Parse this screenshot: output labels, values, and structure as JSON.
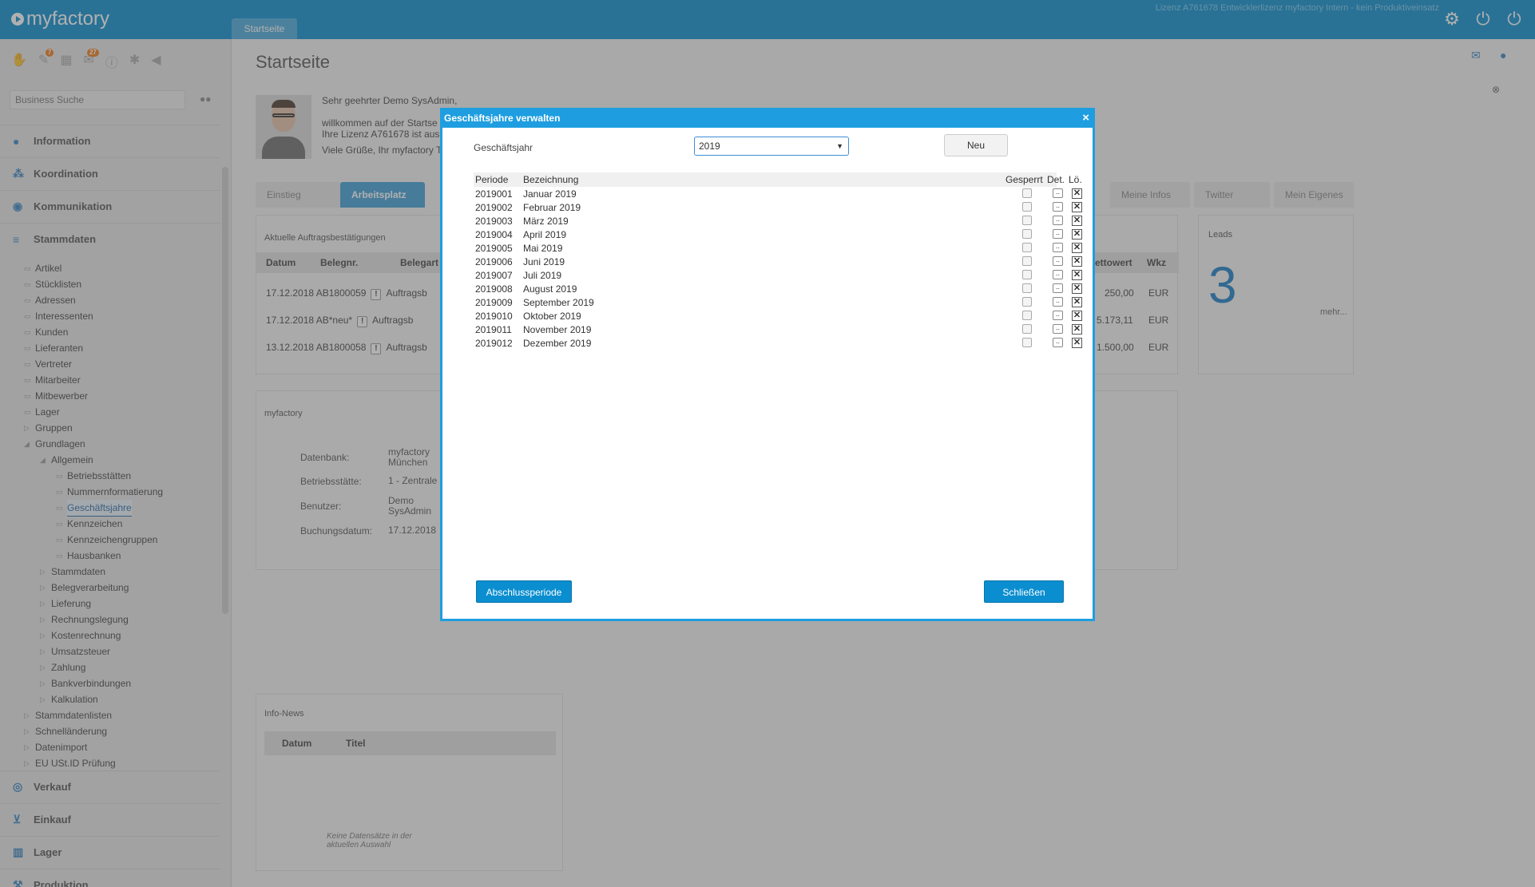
{
  "topbar": {
    "logo": "myfactory",
    "tab": "Startseite",
    "license": "Lizenz A761678 Entwicklerlizenz myfactory Intern - kein Produktiveinsatz",
    "icons": [
      "gear-icon",
      "power-icon",
      "power-plus-icon"
    ]
  },
  "sidebar": {
    "badges": {
      "b1": "7",
      "b2": "27"
    },
    "search_placeholder": "Business Suche",
    "sections_top": [
      "Information",
      "Koordination",
      "Kommunikation",
      "Stammdaten"
    ],
    "tree": [
      "Artikel",
      "Stücklisten",
      "Adressen",
      "Interessenten",
      "Kunden",
      "Lieferanten",
      "Vertreter",
      "Mitarbeiter",
      "Mitbewerber",
      "Lager",
      "Gruppen",
      "Grundlagen",
      "Allgemein",
      "Betriebsstätten",
      "Nummernformatierung",
      "Geschäftsjahre",
      "Kennzeichen",
      "Kennzeichengruppen",
      "Hausbanken",
      "Stammdaten",
      "Belegverarbeitung",
      "Lieferung",
      "Rechnungslegung",
      "Kostenrechnung",
      "Umsatzsteuer",
      "Zahlung",
      "Bankverbindungen",
      "Kalkulation",
      "Stammdatenlisten",
      "Schnelländerung",
      "Datenimport",
      "EU USt.ID Prüfung"
    ],
    "sections_bottom": [
      "Verkauf",
      "Einkauf",
      "Lager",
      "Produktion"
    ]
  },
  "main": {
    "title": "Startseite",
    "welcome": {
      "line1": "Sehr geehrter Demo SysAdmin,",
      "line2": "willkommen auf der Startse",
      "line3": "Ihre Lizenz A761678 ist aus",
      "line4": "Viele Grüße, Ihr myfactory T"
    },
    "tabs": [
      "Einstieg",
      "Arbeitsplatz",
      "Meine Infos",
      "Twitter",
      "Mein Eigenes"
    ],
    "orders": {
      "title": "Aktuelle Auftragsbestätigungen",
      "cols": [
        "Datum",
        "Belegnr.",
        "Belegart",
        "ettowert",
        "Wkz"
      ],
      "rows": [
        {
          "date": "17.12.2018",
          "nr": "AB1800059",
          "art": "Auftragsb",
          "value": "250,00",
          "cur": "EUR"
        },
        {
          "date": "17.12.2018",
          "nr": "AB*neu*",
          "art": "Auftragsb",
          "value": "5.173,11",
          "cur": "EUR"
        },
        {
          "date": "13.12.2018",
          "nr": "AB1800058",
          "art": "Auftragsb",
          "value": "1.500,00",
          "cur": "EUR"
        }
      ]
    },
    "leads": {
      "title": "Leads",
      "value": "3",
      "more": "mehr..."
    },
    "myfactory": {
      "title": "myfactory",
      "labels": [
        "Datenbank:",
        "Betriebsstätte:",
        "Benutzer:",
        "Buchungsdatum:"
      ],
      "values": [
        "myfactory München",
        "1 - Zentrale",
        "Demo SysAdmin",
        "17.12.2018"
      ]
    },
    "news": {
      "title": "Info-News",
      "cols": [
        "Datum",
        "Titel"
      ],
      "empty": "Keine Datensätze in der aktuellen Auswahl"
    }
  },
  "dialog": {
    "title": "Geschäftsjahre verwalten",
    "label_year": "Geschäftsjahr",
    "selected_year": "2019",
    "new_button": "Neu",
    "columns": {
      "periode": "Periode",
      "bezeichnung": "Bezeichnung",
      "gesperrt": "Gesperrt",
      "det": "Det.",
      "lo": "Lö."
    },
    "rows": [
      {
        "periode": "2019001",
        "bezeichnung": "Januar 2019"
      },
      {
        "periode": "2019002",
        "bezeichnung": "Februar 2019"
      },
      {
        "periode": "2019003",
        "bezeichnung": "März 2019"
      },
      {
        "periode": "2019004",
        "bezeichnung": "April 2019"
      },
      {
        "periode": "2019005",
        "bezeichnung": "Mai 2019"
      },
      {
        "periode": "2019006",
        "bezeichnung": "Juni 2019"
      },
      {
        "periode": "2019007",
        "bezeichnung": "Juli 2019"
      },
      {
        "periode": "2019008",
        "bezeichnung": "August 2019"
      },
      {
        "periode": "2019009",
        "bezeichnung": "September 2019"
      },
      {
        "periode": "2019010",
        "bezeichnung": "Oktober 2019"
      },
      {
        "periode": "2019011",
        "bezeichnung": "November 2019"
      },
      {
        "periode": "2019012",
        "bezeichnung": "Dezember 2019"
      }
    ],
    "btn_close_period": "Abschlussperiode",
    "btn_close": "Schließen"
  }
}
